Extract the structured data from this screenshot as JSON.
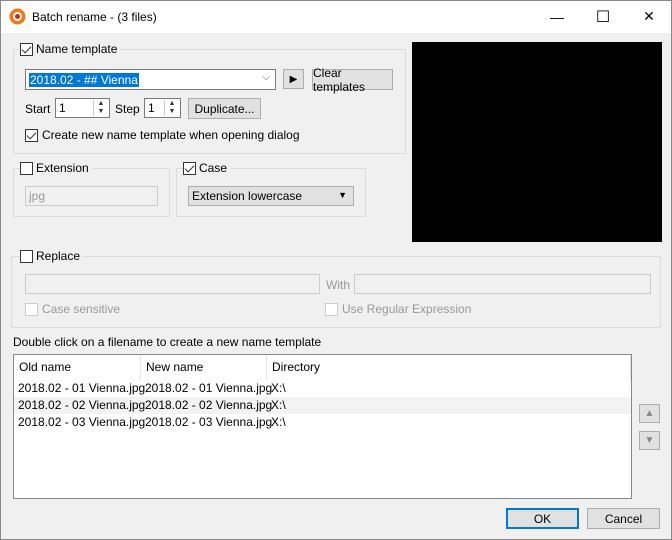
{
  "window": {
    "title": "Batch rename - (3 files)",
    "minimize": "—",
    "maximize": "☐",
    "close": "✕"
  },
  "name_template": {
    "label": "Name template",
    "checked": true,
    "value": "2018.02 - ## Vienna",
    "clear_label": "Clear templates",
    "start_label": "Start",
    "start_value": "1",
    "step_label": "Step",
    "step_value": "1",
    "duplicate_label": "Duplicate...",
    "create_new_label": "Create new name template when opening dialog",
    "create_new_checked": true
  },
  "extension": {
    "label": "Extension",
    "checked": false,
    "value": "jpg"
  },
  "case": {
    "label": "Case",
    "checked": true,
    "value": "Extension lowercase"
  },
  "replace": {
    "label": "Replace",
    "checked": false,
    "find": "",
    "with_label": "With",
    "with": "",
    "case_sensitive_label": "Case sensitive",
    "regex_label": "Use Regular Expression"
  },
  "hint": "Double click on a filename to create a new name template",
  "files": {
    "columns": [
      "Old name",
      "New name",
      "Directory"
    ],
    "rows": [
      [
        "2018.02 - 01 Vienna.jpg",
        "2018.02 - 01 Vienna.jpg",
        "X:\\"
      ],
      [
        "2018.02 - 02 Vienna.jpg",
        "2018.02 - 02 Vienna.jpg",
        "X:\\"
      ],
      [
        "2018.02 - 03 Vienna.jpg",
        "2018.02 - 03 Vienna.jpg",
        "X:\\"
      ]
    ]
  },
  "buttons": {
    "ok": "OK",
    "cancel": "Cancel"
  }
}
